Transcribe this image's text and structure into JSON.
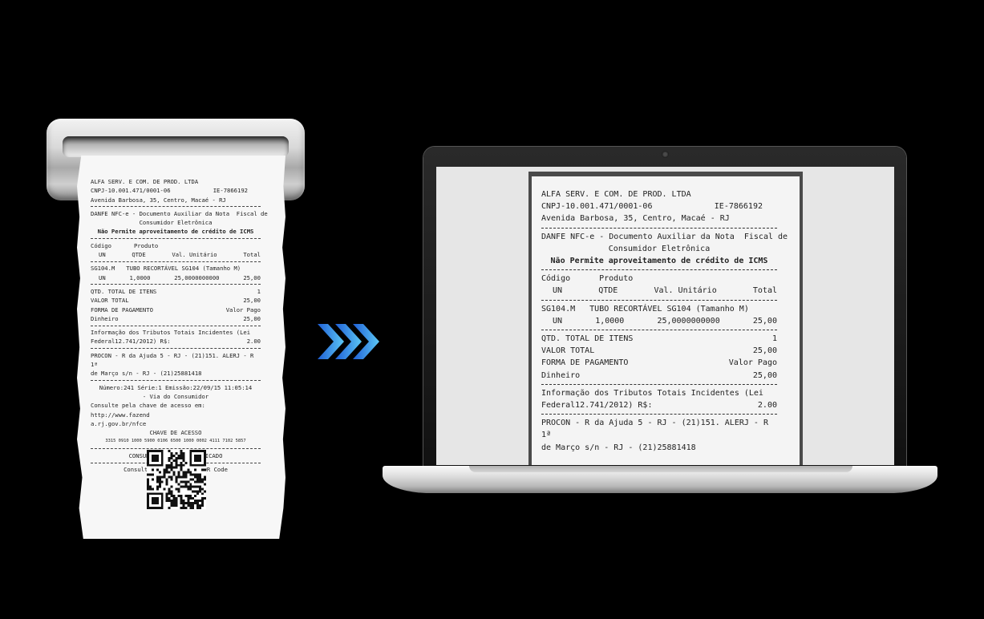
{
  "receipt": {
    "company": "ALFA SERV. E COM. DE PROD. LTDA",
    "cnpj": "CNPJ-10.001.471/0001-06",
    "ie": "IE-7866192",
    "address": "Avenida Barbosa, 35, Centro, Macaé - RJ",
    "danfe_line1": "DANFE NFC-e - Documento Auxiliar da Nota  Fiscal de",
    "danfe_line2": "Consumidor Eletrônica",
    "icms_note": "Não Permite aproveitamento de crédito de ICMS",
    "hdr_codigo": "Código",
    "hdr_produto": "Produto",
    "hdr_un": "UN",
    "hdr_qtde": "QTDE",
    "hdr_val_unit": "Val. Unitário",
    "hdr_total": "Total",
    "item_code": "SG104.M",
    "item_desc": "TUBO RECORTÁVEL SG104 (Tamanho M)",
    "item_un": "UN",
    "item_qty": "1,0000",
    "item_unit_price": "25,0000000000",
    "item_total": "25,00",
    "qtd_total_label": "QTD. TOTAL DE ITENS",
    "qtd_total_value": "1",
    "valor_total_label": "VALOR TOTAL",
    "valor_total_value": "25,00",
    "forma_pag_label": "FORMA DE PAGAMENTO",
    "valor_pago_label": "Valor Pago",
    "dinheiro_label": "Dinheiro",
    "dinheiro_value": "25,00",
    "tributos_line1": "Informação dos Tributos Totais Incidentes (Lei",
    "tributos_line2": "Federal12.741/2012) R$:",
    "tributos_value": "2.00",
    "procon_line1": "PROCON - R da Ajuda 5 - RJ - (21)151. ALERJ - R 1ª",
    "procon_line2": "de Março s/n - RJ - (21)25881418",
    "numero_line": "Número:241 Série:1 Emissão:22/09/15 11:05:14",
    "via_line": "- Via do Consumidor",
    "consulte_line1": "Consulte pela chave de acesso em: http://www.fazend",
    "consulte_line2": "a.rj.gov.br/nfce",
    "chave_label": "CHAVE DE ACESSO",
    "chave_value": "3315 0910 1000 5900 0106 6500 1000 0002 4111 7102 5857",
    "consumidor": "CONSUMIDOR NÃO IDENTIFICADO",
    "qr_label": "Consulta via leitor de QR Code"
  },
  "colors": {
    "arrow_dark": "#1f5fd6",
    "arrow_light": "#5cc8f5",
    "background": "#000000",
    "paper": "#f7f7f7"
  },
  "icons": [
    "printer-slot-icon",
    "triple-chevron-right-icon",
    "laptop-icon",
    "qr-code-icon"
  ]
}
